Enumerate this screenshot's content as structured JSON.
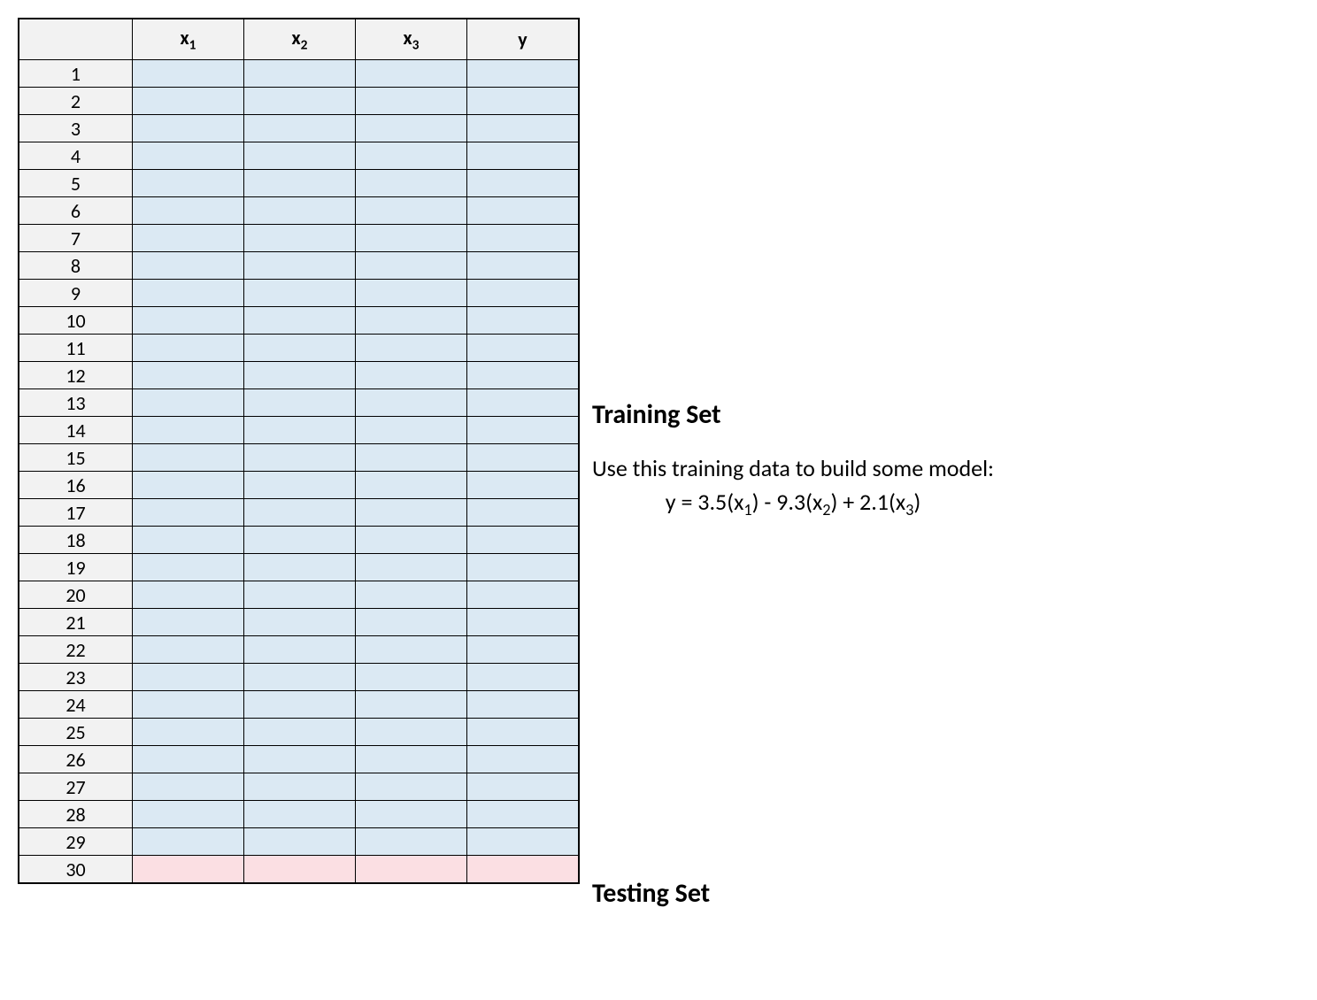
{
  "headers": {
    "blank": "",
    "x1": "x",
    "x1_sub": "1",
    "x2": "x",
    "x2_sub": "2",
    "x3": "x",
    "x3_sub": "3",
    "y": "y"
  },
  "rows": {
    "total": 30,
    "training_last": 29,
    "testing_first": 30
  },
  "annotations": {
    "training": {
      "title": "Training Set",
      "desc": "Use this training data to build some model:",
      "eq_pre": "y = 3.5(x",
      "eq_s1": "1",
      "eq_mid1": ") - 9.3(x",
      "eq_s2": "2",
      "eq_mid2": ") + 2.1(x",
      "eq_s3": "3",
      "eq_post": ")"
    },
    "testing": {
      "title": "Testing Set"
    }
  }
}
